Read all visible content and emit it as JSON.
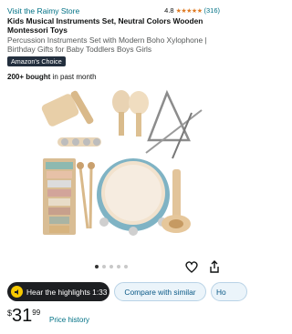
{
  "header": {
    "store_link": "Visit the Raimy Store",
    "rating_value": "4.8",
    "rating_stars": "★★★★★",
    "rating_count": "(316)"
  },
  "product": {
    "title": "Kids Musical Instruments Set, Neutral Colors Wooden Montessori Toys",
    "subtitle": "Percussion Instruments Set with Modern Boho Xylophone | Birthday Gifts for Baby Toddlers Boys Girls",
    "badge": "Amazon's Choice",
    "bought_bold": "200+ bought",
    "bought_rest": "in past month"
  },
  "gallery": {
    "dots_total": 5,
    "active_index": 0
  },
  "actions": {
    "hear_label": "Hear the highlights 1:33",
    "compare_label": "Compare with similar",
    "partial_label": "Ho"
  },
  "price": {
    "currency": "$",
    "whole": "31",
    "fraction": "99",
    "history_link": "Price history"
  },
  "colors": {
    "link": "#007185",
    "star": "#de7921",
    "badge_bg": "#232f3e",
    "audio_icon": "#f7ca00"
  },
  "icons": [
    "heart-icon",
    "share-icon",
    "speaker-icon"
  ]
}
